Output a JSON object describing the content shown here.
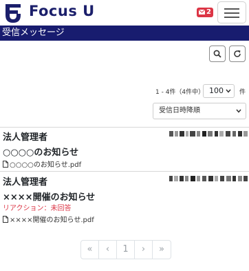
{
  "header": {
    "logo_text": "Focus U",
    "mail_count": "2",
    "brand_color": "#1b1f6b",
    "badge_color": "#dc3545"
  },
  "page": {
    "title": "受信メッセージ"
  },
  "toolbar": {
    "search_icon": "search-icon",
    "refresh_icon": "refresh-icon"
  },
  "listing": {
    "count_text": "1 - 4件（4件中）",
    "per_page_value": "100",
    "per_page_unit": "件",
    "sort_value": "受信日時降順"
  },
  "messages": [
    {
      "sender": "法人管理者",
      "subject": "○○○○のお知らせ",
      "attachment": "○○○○のお知らせ.pdf"
    },
    {
      "sender": "法人管理者",
      "subject": "××××開催のお知らせ",
      "reaction": "リアクション：未回答",
      "attachment": "××××開催のお知らせ.pdf"
    }
  ],
  "pagination": {
    "first": "«",
    "prev": "‹",
    "current": "1",
    "next": "›",
    "last": "»"
  }
}
